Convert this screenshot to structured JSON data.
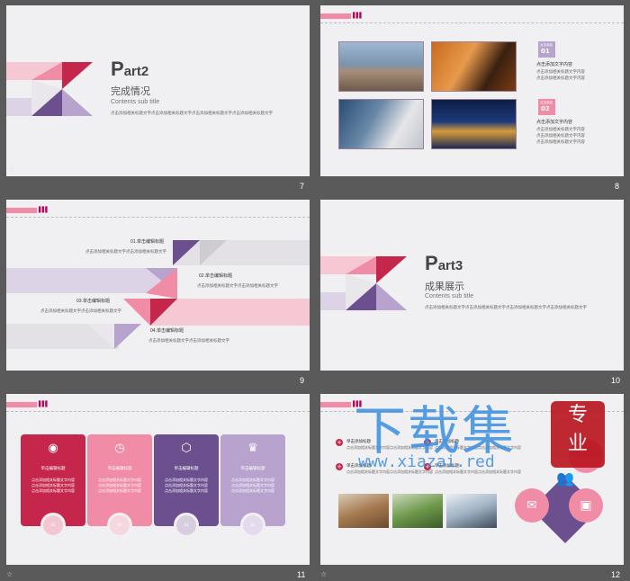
{
  "slides": {
    "s7": {
      "num": "7",
      "part_prefix": "P",
      "part_rest": "art2",
      "title_cn": "完成情况",
      "title_en": "Contents sub title",
      "body": "点击添加相关标题文字点击添加相关标题文字点击添加相关标题文字点击添加相关标题文字"
    },
    "s8": {
      "num": "8",
      "tag1_top": "点击添加",
      "tag1_num": "01",
      "tag2_top": "点击添加",
      "tag2_num": "02",
      "item1_title": "点击添加文字内容",
      "item1_lines": [
        "点击添加相关标题文字内容",
        "点击添加相关标题文字内容"
      ],
      "item2_title": "点击添加文字内容",
      "item2_lines": [
        "点击添加相关标题文字内容",
        "点击添加相关标题文字内容",
        "点击添加相关标题文字内容"
      ]
    },
    "s9": {
      "num": "9",
      "l1": "01.单击编辑标题",
      "l1b": "点击添加相关标题文字点击添加相关标题文字",
      "l2": "02.单击编辑标题",
      "l2b": "点击添加相关标题文字点击添加相关标题文字",
      "l3": "03.单击编辑标题",
      "l3b": "点击添加相关标题文字点击添加相关标题文字",
      "l4": "04.单击编辑标题",
      "l4b": "点击添加相关标题文字点击添加相关标题文字"
    },
    "s10": {
      "num": "10",
      "part_prefix": "P",
      "part_rest": "art3",
      "title_cn": "成果展示",
      "title_en": "Contents sub title",
      "body": "点击添加相关标题文字点击添加相关标题文字点击添加相关标题文字点击添加相关标题文字"
    },
    "s11": {
      "num": "11",
      "cards": [
        {
          "title": "单击编辑标题",
          "line": "点击添加相关标题文字内容",
          "num": "01",
          "color": "#c4264c",
          "icon": "eye-icon",
          "glyph": "◉"
        },
        {
          "title": "单击编辑标题",
          "line": "点击添加相关标题文字内容",
          "num": "02",
          "color": "#f08ca6",
          "icon": "clock-icon",
          "glyph": "◷"
        },
        {
          "title": "单击编辑标题",
          "line": "点击添加相关标题文字内容",
          "num": "03",
          "color": "#6b4f8f",
          "icon": "cube-icon",
          "glyph": "⬡"
        },
        {
          "title": "单击编辑标题",
          "line": "点击添加相关标题文字内容",
          "num": "04",
          "color": "#b8a3cf",
          "icon": "trophy-icon",
          "glyph": "♛"
        }
      ]
    },
    "s12": {
      "num": "12",
      "items": [
        {
          "title": "单击添加标题",
          "line": "点击添加相关标题文字内容点击添加相关标题文字内容"
        },
        {
          "title": "单击添加标题",
          "line": "点击添加相关标题文字内容点击添加相关标题文字内容"
        },
        {
          "title": "单击添加标题",
          "line": "点击添加相关标题文字内容点击添加相关标题文字内容"
        },
        {
          "title": "单击添加标题",
          "line": "点击添加相关标题文字内容点击添加相关标题文字内容"
        }
      ]
    }
  },
  "watermark": {
    "cn": "下载集",
    "seal_top": "专",
    "seal_bottom": "业",
    "url": "www.xiazai.red"
  },
  "colors": {
    "accent_pink": "#f08ca6",
    "accent_crimson": "#c4264c",
    "accent_purple": "#6b4f8f",
    "accent_lavender": "#b8a3cf",
    "bg_slide": "#f0eff1",
    "bg_app": "#5a5a5a"
  }
}
